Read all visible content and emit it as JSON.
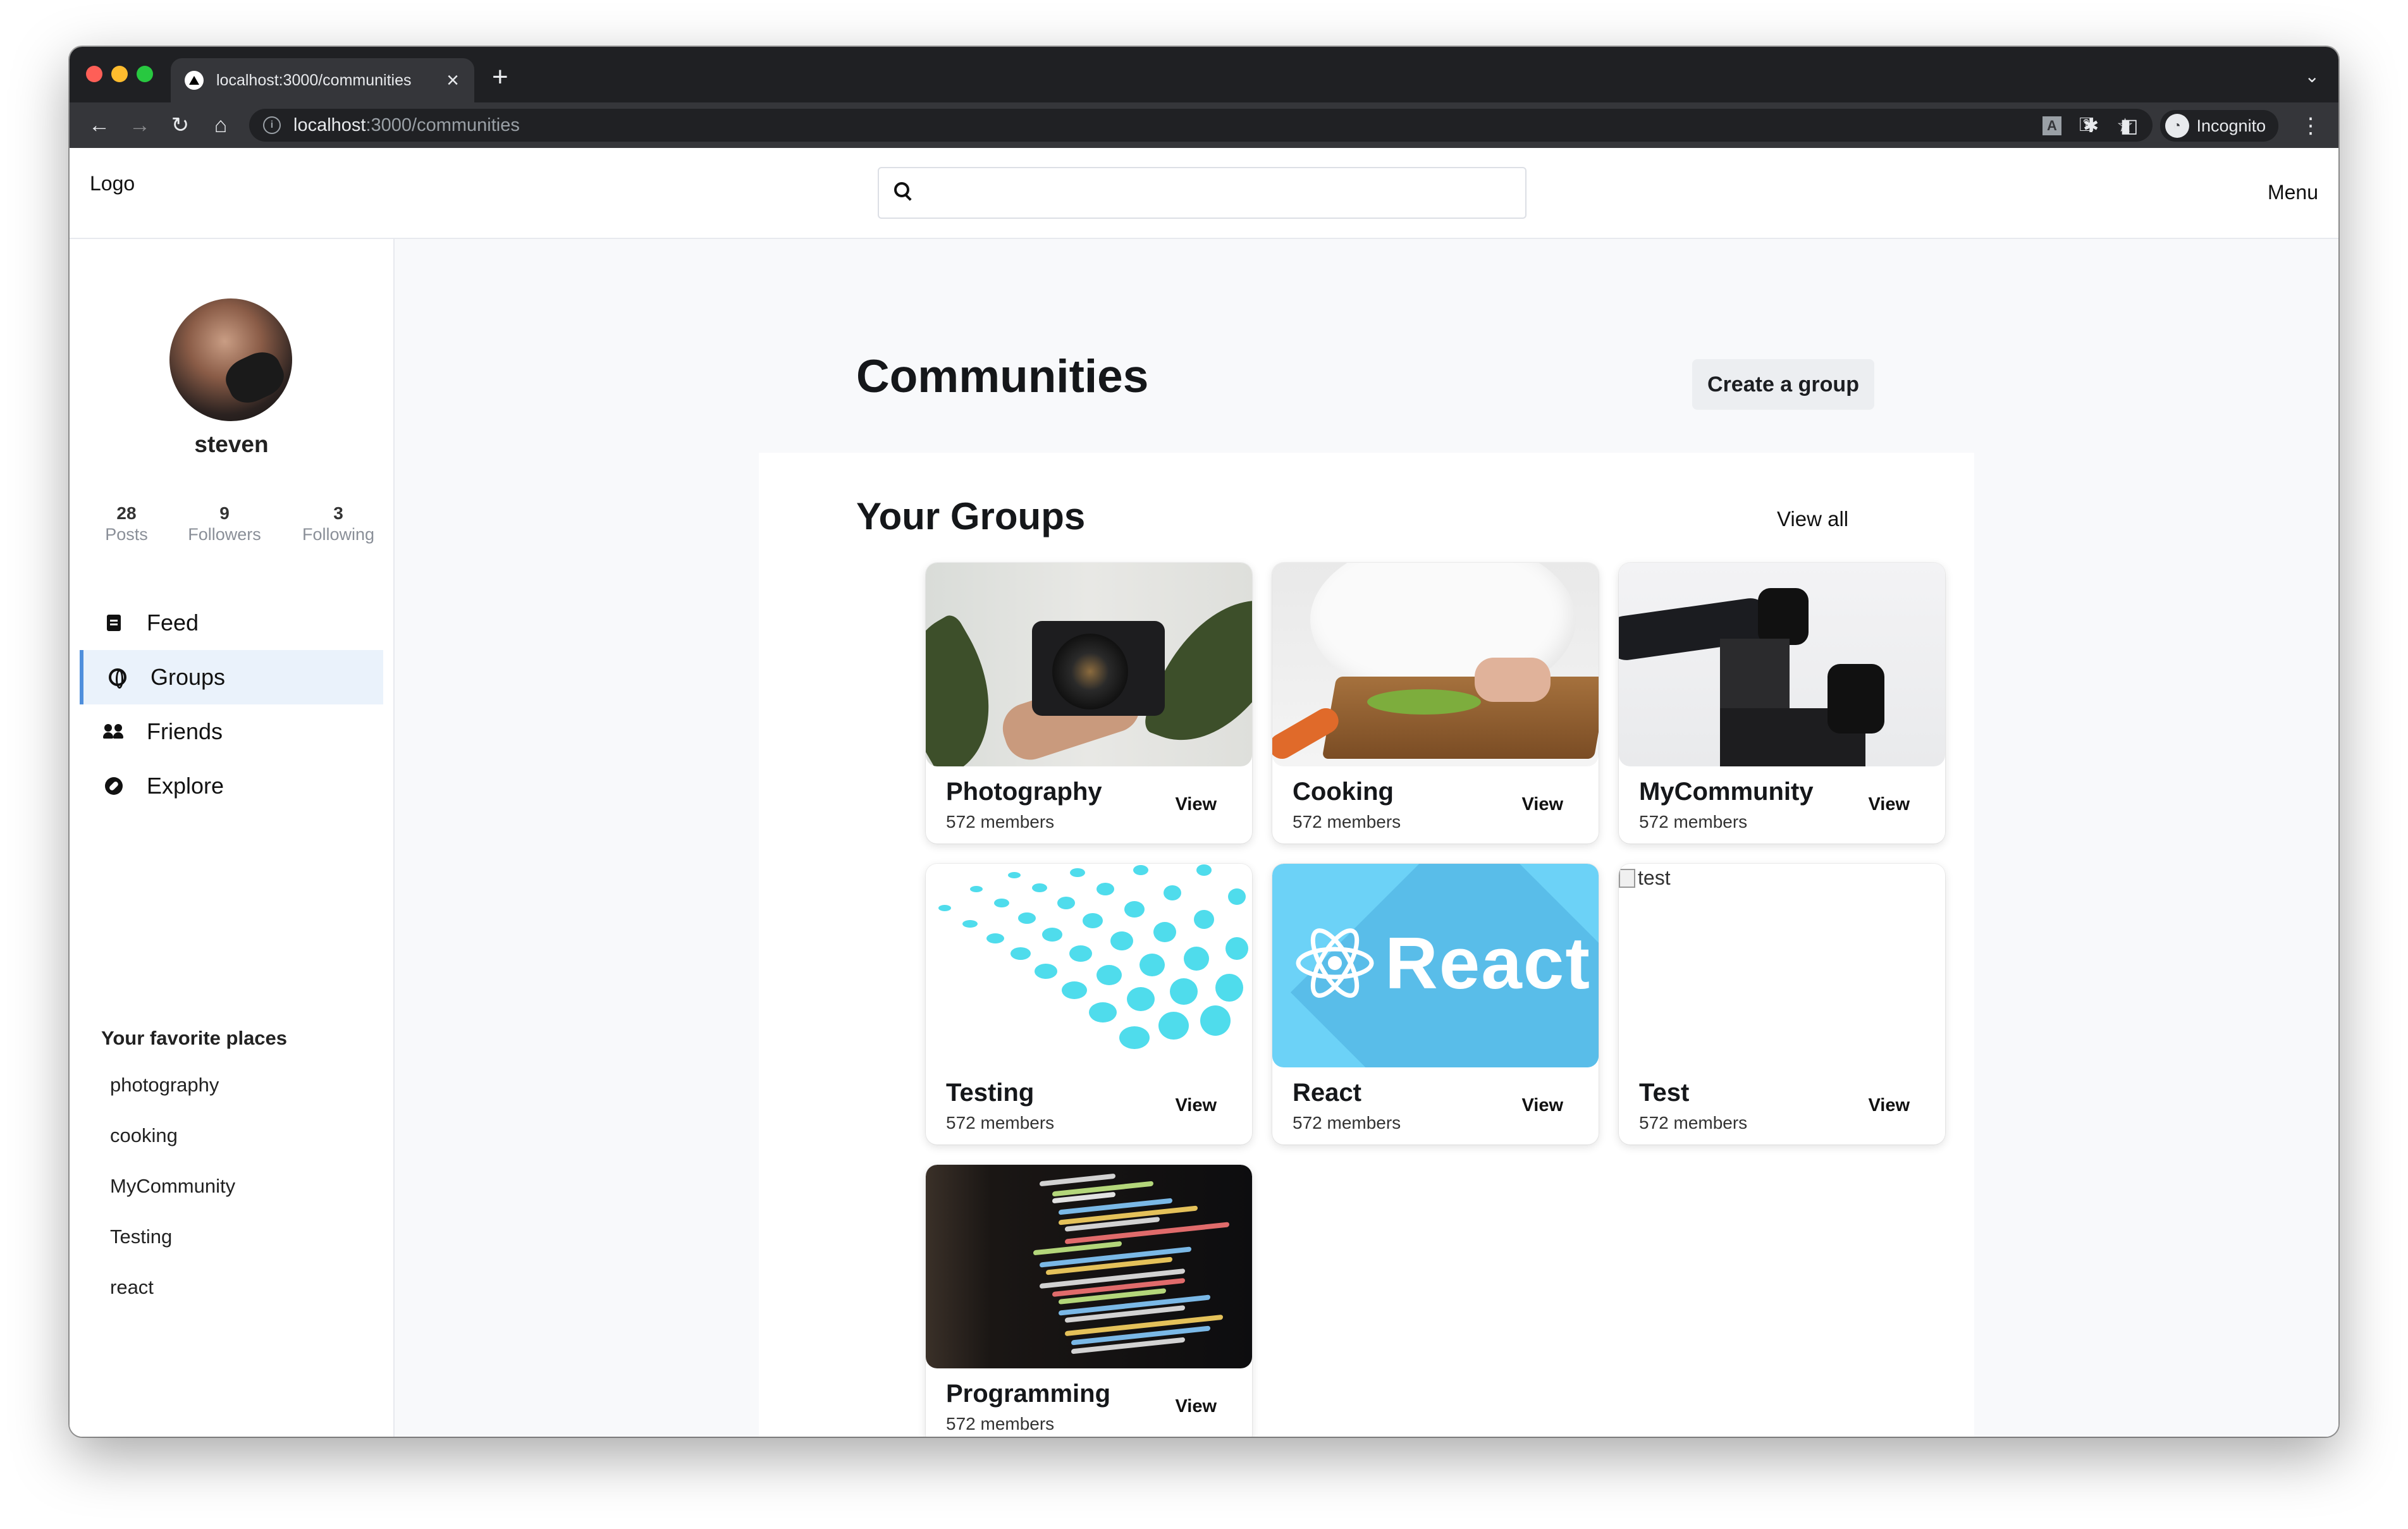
{
  "browser": {
    "tab_title": "localhost:3000/communities",
    "url_host": "localhost",
    "url_path": ":3000/communities",
    "incognito_label": "Incognito"
  },
  "header": {
    "logo": "Logo",
    "search_placeholder": "",
    "menu": "Menu"
  },
  "profile": {
    "username": "steven",
    "stats": [
      {
        "value": "28",
        "label": "Posts"
      },
      {
        "value": "9",
        "label": "Followers"
      },
      {
        "value": "3",
        "label": "Following"
      }
    ]
  },
  "nav": [
    {
      "label": "Feed",
      "icon": "feed-icon",
      "active": false
    },
    {
      "label": "Groups",
      "icon": "globe-icon",
      "active": true
    },
    {
      "label": "Friends",
      "icon": "users-icon",
      "active": false
    },
    {
      "label": "Explore",
      "icon": "compass-icon",
      "active": false
    }
  ],
  "favorites": {
    "title": "Your favorite places",
    "items": [
      "photography",
      "cooking",
      "MyCommunity",
      "Testing",
      "react"
    ]
  },
  "main": {
    "title": "Communities",
    "create_button": "Create a group",
    "groups_title": "Your Groups",
    "view_all": "View all",
    "react_logo_text": "React",
    "broken_image_alt": "test",
    "groups": [
      {
        "name": "Photography",
        "members": "572 members",
        "action": "View"
      },
      {
        "name": "Cooking",
        "members": "572 members",
        "action": "View"
      },
      {
        "name": "MyCommunity",
        "members": "572 members",
        "action": "View"
      },
      {
        "name": "Testing",
        "members": "572 members",
        "action": "View"
      },
      {
        "name": "React",
        "members": "572 members",
        "action": "View"
      },
      {
        "name": "Test",
        "members": "572 members",
        "action": "View"
      },
      {
        "name": "Programming",
        "members": "572 members",
        "action": "View"
      }
    ]
  },
  "colors": {
    "accent": "#4f8fdc",
    "active_nav_bg": "#eaf2fb",
    "react_bg": "#6cd2f7",
    "page_bg": "#f8f9fb"
  }
}
